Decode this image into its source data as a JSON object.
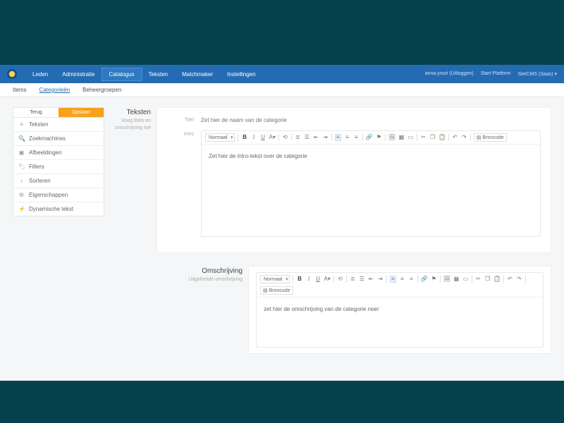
{
  "nav": {
    "main": [
      "Leden",
      "Administratie",
      "Catalogus",
      "Teksten",
      "Matchmaker",
      "Instellingen"
    ],
    "sub": [
      "Items",
      "Categorieën",
      "Beheergroepen"
    ]
  },
  "topbar": {
    "user": "anna.youri (Uitloggen)",
    "platform": "Start Platform",
    "brand": "SiteCMS (Saas) ▾"
  },
  "sidebar": {
    "back": "Terug",
    "save": "Opslaan",
    "items": [
      "Teksten",
      "Zoekmachines",
      "Afbeeldingen",
      "Filters",
      "Sorteren",
      "Eigenschappen",
      "Dynamische tekst"
    ]
  },
  "sections": {
    "teksten": {
      "title": "Teksten",
      "sub": "Voeg titels en omschrijving toe"
    },
    "omschrijving": {
      "title": "Omschrijving",
      "sub": "Uitgebreide omschrijving"
    }
  },
  "fields": {
    "title": {
      "label": "Titel",
      "placeholder": "Zet hier de naam van de categorie"
    },
    "intro": {
      "label": "Intro",
      "value": "Zet hier de intro-tekst over de categorie"
    },
    "omschrijving": {
      "value": "zet hier de omschrijving van de categorie neer"
    }
  },
  "toolbar": {
    "format": "Normaal",
    "source": "Broncode"
  }
}
